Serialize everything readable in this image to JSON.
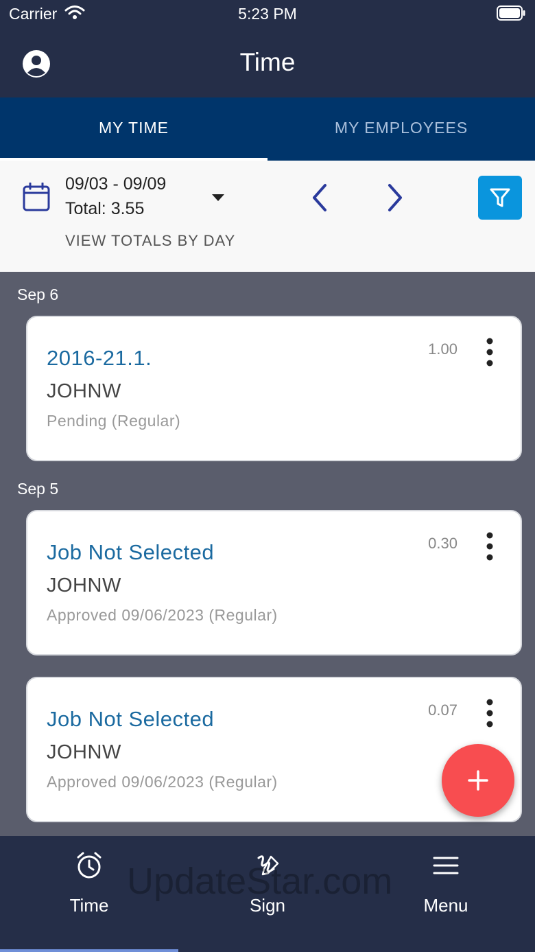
{
  "status_bar": {
    "carrier": "Carrier",
    "time": "5:23 PM"
  },
  "header": {
    "title": "Time"
  },
  "tabs": [
    {
      "label": "MY TIME",
      "active": true
    },
    {
      "label": "MY EMPLOYEES",
      "active": false
    }
  ],
  "date_range": {
    "range": "09/03 - 09/09",
    "total": "Total: 3.55",
    "view_totals": "VIEW TOTALS BY DAY"
  },
  "groups": [
    {
      "date": "Sep 6",
      "entries": [
        {
          "job": "2016-21.1.",
          "user": "JOHNW",
          "status": "Pending (Regular)",
          "hours": "1.00"
        }
      ]
    },
    {
      "date": "Sep 5",
      "entries": [
        {
          "job": "Job Not Selected",
          "user": "JOHNW",
          "status": "Approved 09/06/2023 (Regular)",
          "hours": "0.30"
        },
        {
          "job": "Job Not Selected",
          "user": "JOHNW",
          "status": "Approved 09/06/2023 (Regular)",
          "hours": "0.07"
        }
      ]
    }
  ],
  "bottom_nav": [
    {
      "label": "Time",
      "icon": "alarm-clock-icon",
      "active": true
    },
    {
      "label": "Sign",
      "icon": "signature-icon",
      "active": false
    },
    {
      "label": "Menu",
      "icon": "hamburger-menu-icon",
      "active": false
    }
  ],
  "watermark": "UpdateStar.com",
  "colors": {
    "header_bg": "#252e48",
    "tab_bg": "#00356b",
    "accent_blue": "#0a95dd",
    "fab_red": "#f84d50",
    "job_link": "#1b6aa0"
  }
}
